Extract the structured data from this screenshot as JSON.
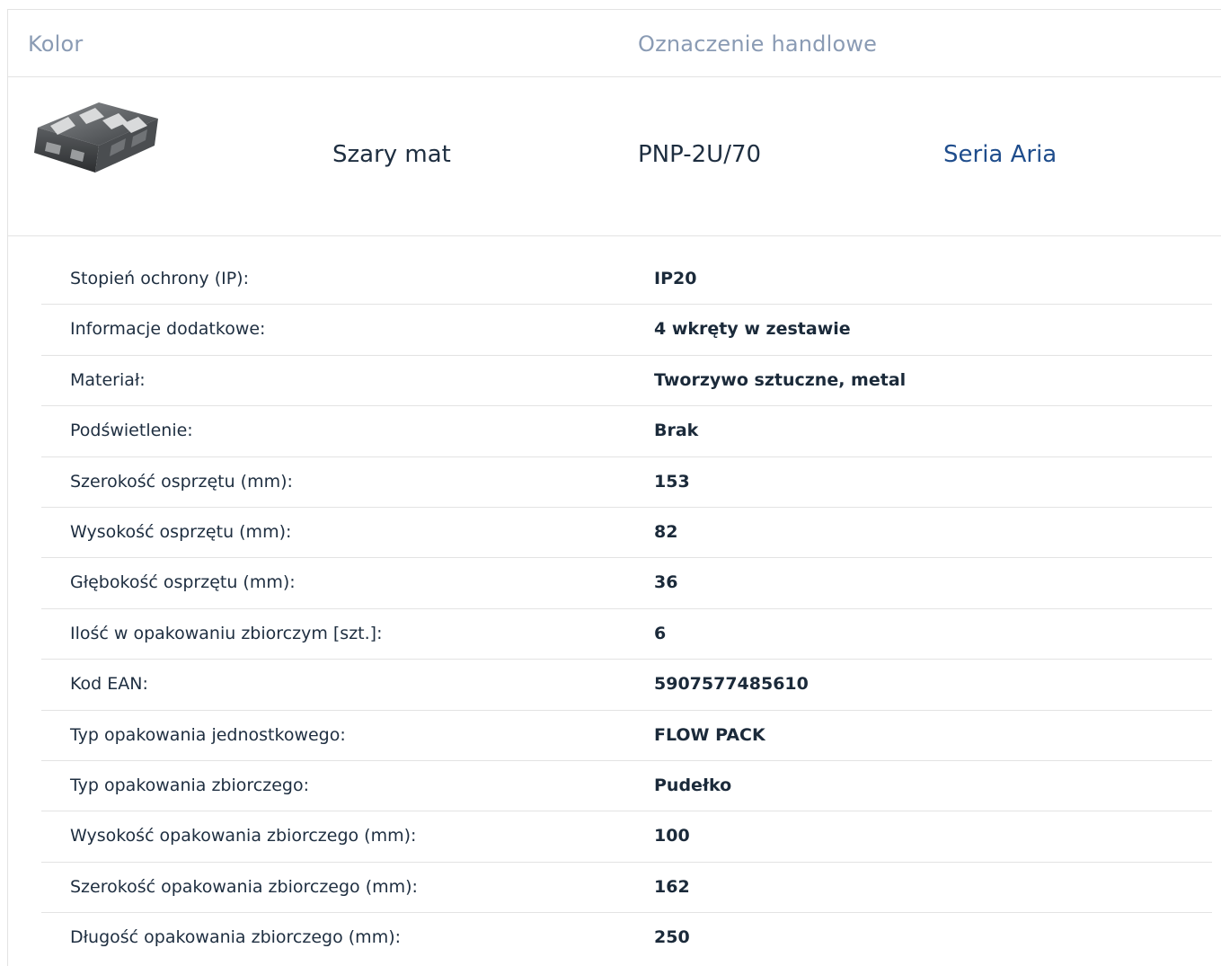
{
  "header": {
    "col_color": "Kolor",
    "col_designation": "Oznaczenie handlowe"
  },
  "product": {
    "image_icon": "product-frame-image",
    "color": "Szary mat",
    "designation": "PNP-2U/70",
    "series_link": "Seria Aria",
    "link_color": "#1f4d8c"
  },
  "specs": [
    {
      "label": "Stopień ochrony (IP):",
      "value": "IP20"
    },
    {
      "label": "Informacje dodatkowe:",
      "value": "4 wkręty w zestawie"
    },
    {
      "label": "Materiał:",
      "value": "Tworzywo sztuczne, metal"
    },
    {
      "label": "Podświetlenie:",
      "value": "Brak"
    },
    {
      "label": "Szerokość osprzętu (mm):",
      "value": "153"
    },
    {
      "label": "Wysokość osprzętu (mm):",
      "value": "82"
    },
    {
      "label": "Głębokość osprzętu (mm):",
      "value": "36"
    },
    {
      "label": "Ilość w opakowaniu zbiorczym [szt.]:",
      "value": "6"
    },
    {
      "label": "Kod EAN:",
      "value": "5907577485610"
    },
    {
      "label": "Typ opakowania jednostkowego:",
      "value": "FLOW PACK"
    },
    {
      "label": "Typ opakowania zbiorczego:",
      "value": "Pudełko"
    },
    {
      "label": "Wysokość opakowania zbiorczego (mm):",
      "value": "100"
    },
    {
      "label": "Szerokość opakowania zbiorczego (mm):",
      "value": "162"
    },
    {
      "label": "Długość opakowania zbiorczego (mm):",
      "value": "250"
    }
  ]
}
